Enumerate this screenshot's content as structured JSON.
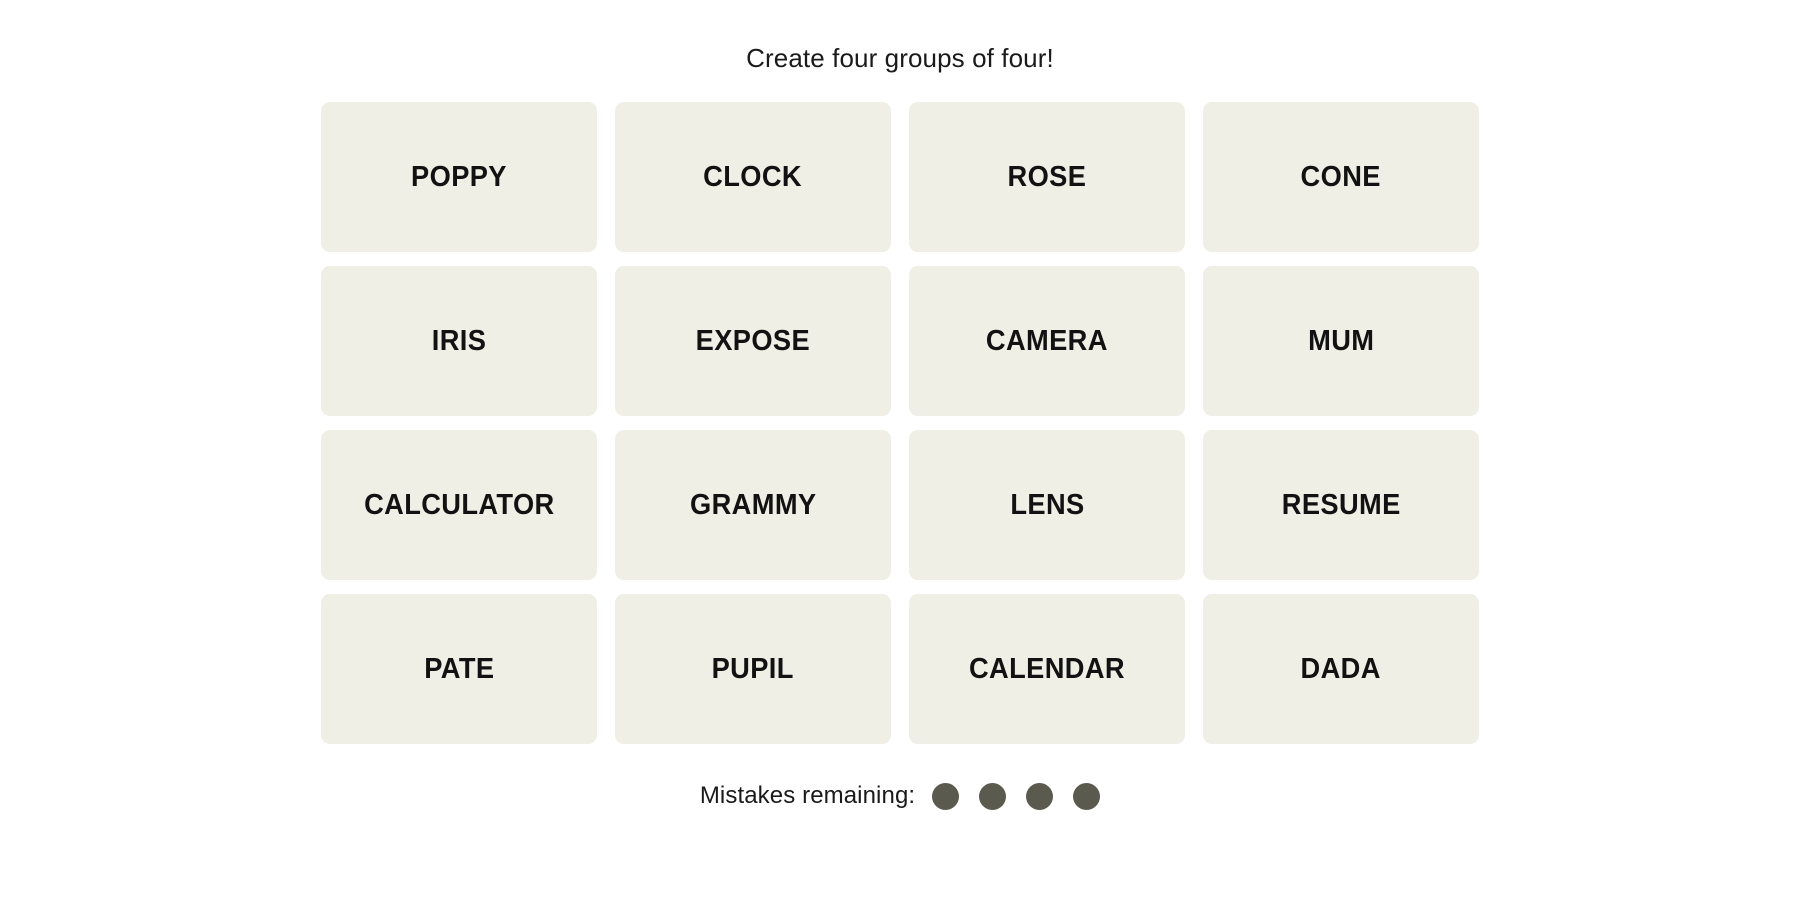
{
  "game": {
    "header_text": "Create four groups of four!",
    "background_color": "#ffffff",
    "tile_color": "#efefe6",
    "tile_text_color": "#121212",
    "dot_color": "#5a5a4e",
    "tiles": [
      {
        "label": "POPPY"
      },
      {
        "label": "CLOCK"
      },
      {
        "label": "ROSE"
      },
      {
        "label": "CONE"
      },
      {
        "label": "IRIS"
      },
      {
        "label": "EXPOSE"
      },
      {
        "label": "CAMERA"
      },
      {
        "label": "MUM"
      },
      {
        "label": "CALCULATOR"
      },
      {
        "label": "GRAMMY"
      },
      {
        "label": "LENS"
      },
      {
        "label": "RESUME"
      },
      {
        "label": "PATE"
      },
      {
        "label": "PUPIL"
      },
      {
        "label": "CALENDAR"
      },
      {
        "label": "DADA"
      }
    ],
    "mistakes": {
      "label": "Mistakes remaining:",
      "remaining": 4,
      "dots": [
        {
          "state": "filled"
        },
        {
          "state": "filled"
        },
        {
          "state": "filled"
        },
        {
          "state": "filled"
        }
      ]
    }
  }
}
